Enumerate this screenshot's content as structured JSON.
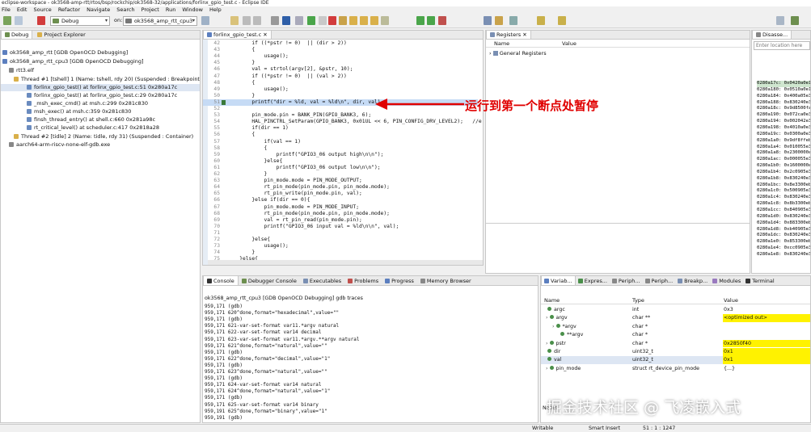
{
  "window": {
    "title": "eclipse-workspace - ok3568-amp-rtt/rtos/bsp/rockchip/ok3568-32/applications/forlinx_gpio_test.c - Eclipse IDE"
  },
  "menu": [
    "File",
    "Edit",
    "Source",
    "Refactor",
    "Navigate",
    "Search",
    "Project",
    "Run",
    "Window",
    "Help"
  ],
  "toolbar": {
    "mode": "Debug",
    "target": "ok3568_amp_rtt_cpu3"
  },
  "debug": {
    "tabs": [
      "Debug",
      "Project Explorer"
    ],
    "tree": [
      "ok3568_amp_rtt [GDB OpenOCD Debugging]",
      "ok3568_amp_rtt_cpu3 [GDB OpenOCD Debugging]",
      "rtt3.elf",
      "Thread #1 [tshell] 1 (Name: tshell, rdy 20) (Suspended : Breakpoint)",
      "forlinx_gpio_test() at forlinx_gpio_test.c:51 0x280a17c",
      "forlinx_gpio_test() at forlinx_gpio_test.c:29 0x280a17c",
      "_msh_exec_cmd() at msh.c:299 0x281c830",
      "msh_exec() at msh.c:359 0x281c830",
      "finsh_thread_entry() at shell.c:660 0x281a98c",
      "rt_critical_level() at scheduler.c:417 0x2818a28",
      "Thread #2 [tidle] 2 (Name: tidle, rdy 31) (Suspended : Container)",
      "aarch64-arm-riscv-none-elf-gdb.exe"
    ]
  },
  "editor": {
    "tab": "forlinx_gpio_test.c",
    "lines": [
      {
        "n": "42",
        "t": "        if ((*pstr != 0)  || (dir > 2))"
      },
      {
        "n": "43",
        "t": "        {"
      },
      {
        "n": "44",
        "t": "            usage();"
      },
      {
        "n": "45",
        "t": "        }"
      },
      {
        "n": "46",
        "t": "        val = strtol(argv[2], &pstr, 10);"
      },
      {
        "n": "47",
        "t": "        if ((*pstr != 0)  || (val > 2))"
      },
      {
        "n": "48",
        "t": "        {"
      },
      {
        "n": "49",
        "t": "            usage();"
      },
      {
        "n": "50",
        "t": "        }"
      },
      {
        "n": "51",
        "t": "        printf(\"dir = %ld, val = %ld\\n\", dir, val);"
      },
      {
        "n": "52",
        "t": ""
      },
      {
        "n": "53",
        "t": "        pin_mode.pin = BANK_PIN(GPIO_BANK3, 6);"
      },
      {
        "n": "54",
        "t": "        HAL_PINCTRL_SetParam(GPIO_BANK3, 0x01UL << 6, PIN_CONFIG_DRV_LEVEL2);   //e"
      },
      {
        "n": "55",
        "t": "        if(dir == 1)"
      },
      {
        "n": "56",
        "t": "        {"
      },
      {
        "n": "57",
        "t": "            if(val == 1)"
      },
      {
        "n": "58",
        "t": "            {"
      },
      {
        "n": "59",
        "t": "                printf(\"GPIO3_06 output high\\n\\n\");"
      },
      {
        "n": "60",
        "t": "            }else{"
      },
      {
        "n": "61",
        "t": "                printf(\"GPIO3_06 output low\\n\\n\");"
      },
      {
        "n": "62",
        "t": "            }"
      },
      {
        "n": "63",
        "t": "            pin_mode.mode = PIN_MODE_OUTPUT;"
      },
      {
        "n": "64",
        "t": "            rt_pin_mode(pin_mode.pin, pin_mode.mode);"
      },
      {
        "n": "65",
        "t": "            rt_pin_write(pin_mode.pin, val);"
      },
      {
        "n": "66",
        "t": "        }else if(dir == 0){"
      },
      {
        "n": "67",
        "t": "            pin_mode.mode = PIN_MODE_INPUT;"
      },
      {
        "n": "68",
        "t": "            rt_pin_mode(pin_mode.pin, pin_mode.mode);"
      },
      {
        "n": "69",
        "t": "            val = rt_pin_read(pin_mode.pin);"
      },
      {
        "n": "70",
        "t": "            printf(\"GPIO3_06 input val = %ld\\n\\n\", val);"
      },
      {
        "n": "71",
        "t": ""
      },
      {
        "n": "72",
        "t": "        }else{"
      },
      {
        "n": "73",
        "t": "            usage();"
      },
      {
        "n": "74",
        "t": "        }"
      },
      {
        "n": "75",
        "t": "    }else{"
      },
      {
        "n": "76",
        "t": "        usage();"
      }
    ]
  },
  "annotation": "运行到第一个断点处暂停",
  "registers": {
    "tab": "Registers",
    "col_name": "Name",
    "col_value": "Value",
    "group": "General Registers"
  },
  "disassembly": {
    "tab": "Disasse...",
    "placeholder": "Enter location here",
    "lines": [
      "0280a17c: 0x0420a0e1",
      "0280a180: 0x0510a0e1",
      "0280a184: 0x400a05e3",
      "0280a188: 0x830240e3",
      "0280a18c: 0x9d8500fa",
      "0280a190: 0x072ca0e3",
      "0280a194: 0x002042e3",
      "0280a198: 0x4010a0e3",
      "0280a19c: 0x0300a0e3",
      "0280a1a0: 0x9df8ffeb",
      "0280a1a4: 0x010055e3",
      "0280a1a8: 0x2300000a",
      "0280a1ac: 0x000055e3",
      "0280a1b0: 0x1600000a",
      "0280a1b4: 0x2c0905e3",
      "0280a1b8: 0x830240e3",
      "0280a1bc: 0x8e3300eb",
      "0280a1c0: 0x500905e3",
      "0280a1c4: 0x830240e3",
      "0280a1c8: 0x8b3300eb",
      "0280a1cc: 0x840905e3",
      "0280a1d0: 0x830240e3",
      "0280a1d4: 0x883300eb",
      "0280a1d8: 0xb40905e3",
      "0280a1dc: 0x830240e3",
      "0280a1e0: 0x853300eb",
      "0280a1e4: 0xcc0905e3",
      "0280a1e8: 0x830240e3"
    ]
  },
  "console": {
    "tabs": [
      "Console",
      "Debugger Console",
      "Executables",
      "Problems",
      "Progress",
      "Memory Browser"
    ],
    "header": "ok3568_amp_rtt_cpu3 [GDB OpenOCD Debugging] gdb traces",
    "lines": [
      "959,171 (gdb)",
      "959,171 620^done,format=\"hexadecimal\",value=\"\"",
      "959,171 (gdb)",
      "959,171 621-var-set-format var11.*argv natural",
      "959,171 622-var-set-format var14 decimal",
      "959,171 623-var-set-format var11.*argv.**argv natural",
      "959,171 621^done,format=\"natural\",value=\"\"",
      "959,171 (gdb)",
      "959,171 622^done,format=\"decimal\",value=\"1\"",
      "959,171 (gdb)",
      "959,171 623^done,format=\"natural\",value=\"\"",
      "959,171 (gdb)",
      "959,171 624-var-set-format var14 natural",
      "959,171 624^done,format=\"natural\",value=\"1\"",
      "959,171 (gdb)",
      "959,171 625-var-set-format var14 binary",
      "959,191 625^done,format=\"binary\",value=\"1\"",
      "959,191 (gdb)"
    ]
  },
  "variables": {
    "tabs": [
      "Variab...",
      "Expres...",
      "Periph...",
      "Periph...",
      "Breakp...",
      "Modules",
      "Terminal"
    ],
    "columns": [
      "Name",
      "Type",
      "Value"
    ],
    "rows": [
      {
        "name": "argc",
        "type": "int",
        "value": "0x3",
        "hl": false
      },
      {
        "name": "argv",
        "type": "char **",
        "value": "<optimized out>",
        "hl": true
      },
      {
        "name": "*argv",
        "type": "char *",
        "value": "",
        "hl": true
      },
      {
        "name": "**argv",
        "type": "char *",
        "value": "",
        "hl": true
      },
      {
        "name": "pstr",
        "type": "char *",
        "value": "0x2850f40",
        "hl": true
      },
      {
        "name": "dir",
        "type": "uint32_t",
        "value": "0x1",
        "hl": true
      },
      {
        "name": "val",
        "type": "uint32_t",
        "value": "0x1",
        "hl": true
      },
      {
        "name": "pin_mode",
        "type": "struct rt_device_pin_mode",
        "value": "{...}",
        "hl": false
      }
    ],
    "name_label": "Name"
  },
  "statusbar": {
    "mode": "Writable",
    "insert": "Smart Insert",
    "pos": "51 : 1 : 1247"
  },
  "watermark": "掘金技术社区 @ 飞凌嵌入式"
}
